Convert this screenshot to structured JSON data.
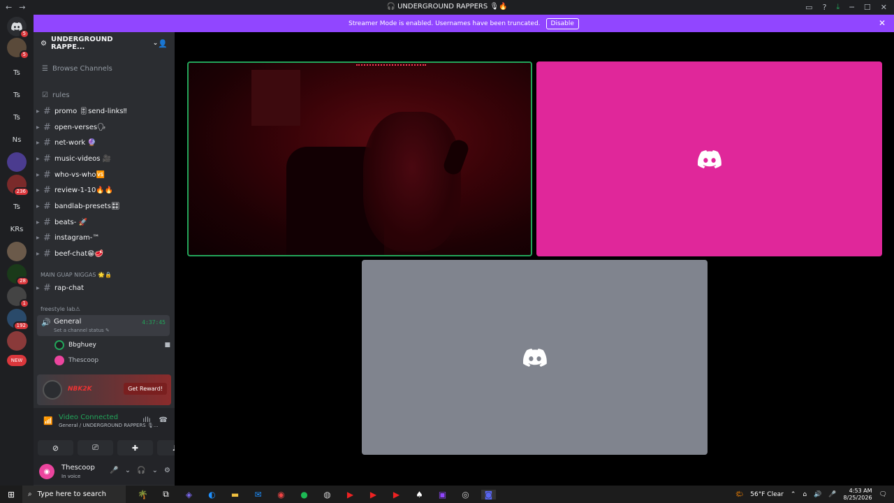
{
  "titlebar": {
    "title": "🎧 UNDERGROUND RAPPERS 🎙🔥",
    "back": "←",
    "forward": "→",
    "icons": [
      "inbox-icon",
      "help-icon",
      "download-icon"
    ],
    "minimize": "─",
    "maximize": "☐",
    "close": "✕"
  },
  "banner": {
    "text": "Streamer Mode is enabled. Usernames have been truncated.",
    "button": "Disable",
    "close": "✕"
  },
  "servers": [
    {
      "label": "",
      "badge": "5",
      "kind": "home"
    },
    {
      "label": "",
      "badge": "5",
      "kind": "avatar"
    },
    {
      "label": "Ts",
      "badge": ""
    },
    {
      "label": "Ts",
      "badge": ""
    },
    {
      "label": "Ts",
      "badge": ""
    },
    {
      "label": "Ns",
      "badge": ""
    },
    {
      "label": "",
      "badge": "",
      "kind": "avatar"
    },
    {
      "label": "",
      "badge": "236",
      "kind": "avatar"
    },
    {
      "label": "Ts",
      "badge": ""
    },
    {
      "label": "KRs",
      "badge": ""
    },
    {
      "label": "",
      "badge": "",
      "kind": "avatar"
    },
    {
      "label": "",
      "badge": "28",
      "kind": "avatar"
    },
    {
      "label": "",
      "badge": "1",
      "kind": "avatar"
    },
    {
      "label": "",
      "badge": "192",
      "kind": "avatar"
    },
    {
      "label": "",
      "badge": "",
      "kind": "avatar"
    },
    {
      "label": "NEW",
      "badge": "",
      "kind": "new"
    }
  ],
  "guild": {
    "name": "UNDERGROUND RAPPE...",
    "browse": "Browse Channels"
  },
  "channels": [
    {
      "name": "rules",
      "dim": true
    },
    {
      "name": "promo 🎚send-links‼"
    },
    {
      "name": "open-verses🗣"
    },
    {
      "name": "net-work 🔮"
    },
    {
      "name": "music-videos 🎥"
    },
    {
      "name": "who-vs-who🆚"
    },
    {
      "name": "review-1-10🔥🔥"
    },
    {
      "name": "bandlab-presets🎛"
    },
    {
      "name": "beats- 🚀"
    },
    {
      "name": "instagram-™"
    },
    {
      "name": "beef-chat😁🥩"
    }
  ],
  "category1": "MAIN GUAP NIGGAS 🌟🔒",
  "rap_chat": "rap-chat",
  "category2": "freestyle lab⚠",
  "voice": {
    "name": "General",
    "status": "Set a channel status ✎",
    "time": "4:37:45",
    "members": [
      {
        "name": "Bbghuey",
        "color": "#23a55a"
      },
      {
        "name": "Thescoop",
        "color": "#eb459e"
      }
    ]
  },
  "promo": {
    "text": "NBK2K",
    "button": "Get Reward!"
  },
  "vc": {
    "title": "Video Connected",
    "sub": "General / UNDERGROUND RAPPERS 🎙..."
  },
  "user": {
    "name": "Thescoop",
    "status": "In voice"
  },
  "taskbar": {
    "search": "Type here to search",
    "weather": "56°F  Clear",
    "time": "4:53 AM",
    "date": "8/25/2026"
  },
  "colors": {
    "accent": "#9146ff",
    "pink_tile": "#e0279a",
    "grey_tile": "#80848e",
    "connected": "#23a55a"
  }
}
